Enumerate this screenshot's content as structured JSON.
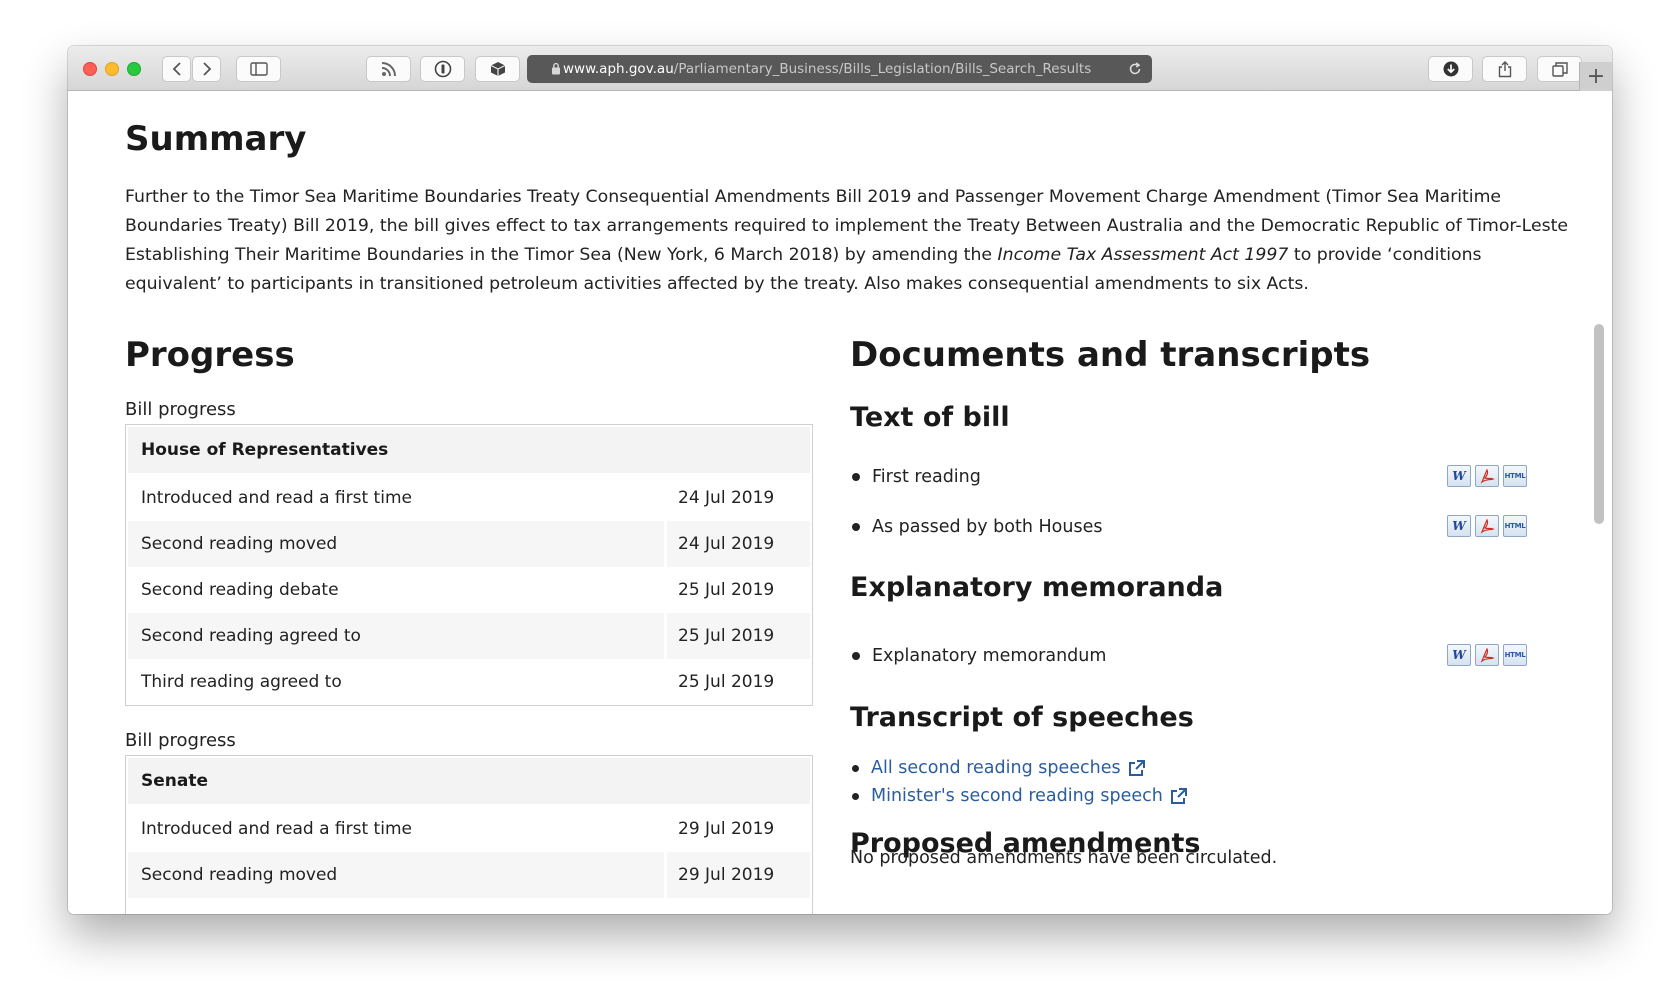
{
  "browser": {
    "url_host": "www.aph.gov.au",
    "url_path": "/Parliamentary_Business/Bills_Legislation/Bills_Search_Results"
  },
  "summary": {
    "title": "Summary",
    "text_before_italic": "Further to the Timor Sea Maritime Boundaries Treaty Consequential Amendments Bill 2019 and Passenger Movement Charge Amendment (Timor Sea Maritime Boundaries Treaty) Bill 2019, the bill gives effect to tax arrangements required to implement the Treaty Between Australia and the Democratic Republic of Timor-Leste Establishing Their Maritime Boundaries in the Timor Sea (New York, 6 March 2018) by amending the ",
    "italic": "Income Tax Assessment Act 1997",
    "text_after_italic": " to provide ‘conditions equivalent’ to participants in transitioned petroleum activities affected by the treaty. Also makes consequential amendments to six Acts."
  },
  "progress": {
    "title": "Progress",
    "tables": [
      {
        "caption": "Bill progress",
        "house": "House of Representatives",
        "rows": [
          {
            "stage": "Introduced and read a first time",
            "date": "24 Jul 2019"
          },
          {
            "stage": "Second reading moved",
            "date": "24 Jul 2019"
          },
          {
            "stage": "Second reading debate",
            "date": "25 Jul 2019"
          },
          {
            "stage": "Second reading agreed to",
            "date": "25 Jul 2019"
          },
          {
            "stage": "Third reading agreed to",
            "date": "25 Jul 2019"
          }
        ]
      },
      {
        "caption": "Bill progress",
        "house": "Senate",
        "rows": [
          {
            "stage": "Introduced and read a first time",
            "date": "29 Jul 2019"
          },
          {
            "stage": "Second reading moved",
            "date": "29 Jul 2019"
          }
        ]
      }
    ]
  },
  "documents": {
    "title": "Documents and transcripts",
    "text_of_bill": {
      "heading": "Text of bill",
      "items": [
        "First reading",
        "As passed by both Houses"
      ]
    },
    "explanatory": {
      "heading": "Explanatory memoranda",
      "items": [
        "Explanatory memorandum"
      ]
    },
    "format_icons": {
      "word": "W",
      "pdf": "pdf-icon",
      "html": "HTML"
    },
    "transcripts": {
      "heading": "Transcript of speeches",
      "links": [
        "All second reading speeches",
        "Minister's second reading speech"
      ]
    },
    "amendments": {
      "heading": "Proposed amendments",
      "text": "No proposed amendments have been circulated."
    }
  },
  "colors": {
    "link": "#2a5d9f",
    "table_header_bg": "#f3f3f3",
    "address_bar": "#585858"
  }
}
